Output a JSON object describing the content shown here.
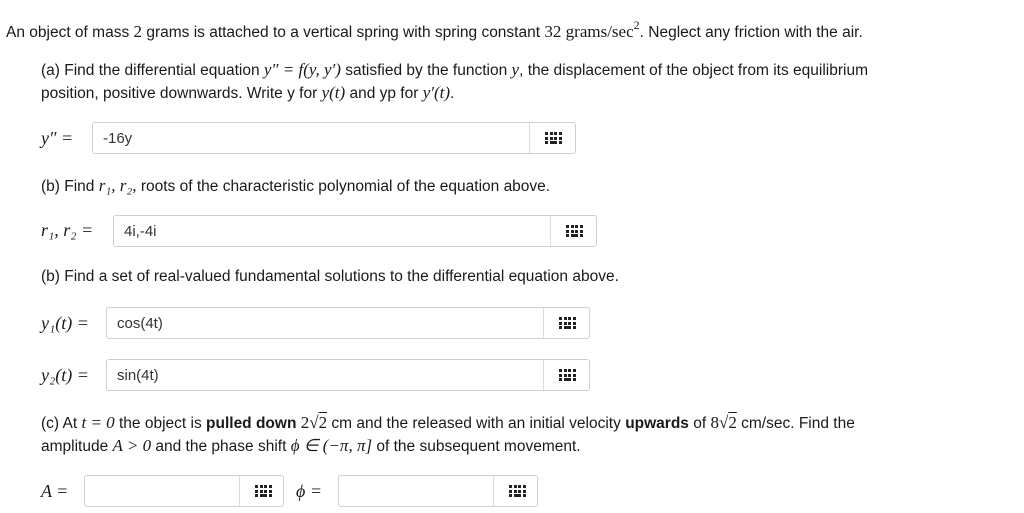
{
  "intro": {
    "text1": "An object of mass ",
    "mass": "2",
    "text2": " grams is attached to a vertical spring with spring constant ",
    "k": "32",
    "units": "grams/sec",
    "units_exp": "2",
    "text3": ". Neglect any friction with the air."
  },
  "part_a": {
    "prompt1": "(a) Find the differential equation ",
    "eq_lhs": "y″",
    "eq_rhs": " = f(y, y′)",
    "prompt2": " satisfied by the function ",
    "var_y": "y",
    "prompt3": ", the displacement of the object from its equilibrium",
    "prompt4": "position, positive downwards. Write y for ",
    "yt": "y(t)",
    "prompt5": " and yp for ",
    "ypt": "y′(t)",
    "prompt6": ".",
    "label": "y″ =",
    "value": "-16y",
    "placeholder": ""
  },
  "part_b1": {
    "prompt1": "(b) Find ",
    "roots": "r₁, r₂,",
    "prompt2": " roots of the characteristic polynomial of the equation above.",
    "label": "r₁, r₂ =",
    "value": "4i,-4i",
    "placeholder": ""
  },
  "part_b2": {
    "prompt": "(b) Find a set of real-valued fundamental solutions to the differential equation above.",
    "y1_label": "y₁(t) =",
    "y1_value": "cos(4t)",
    "y2_label": "y₂(t) =",
    "y2_value": "sin(4t)"
  },
  "part_c": {
    "p1": "(c) At ",
    "t_eq": "t = 0",
    "p2": " the object is ",
    "bold1": "pulled down",
    "p3": " ",
    "disp_coef": "2",
    "disp_rad": "2",
    "p4": " cm and the released with an initial velocity ",
    "bold2": "upwards",
    "p5": " of ",
    "vel_coef": "8",
    "vel_rad": "2",
    "p6": " cm/sec. Find the",
    "p7": "amplitude ",
    "amp_cond": "A > 0",
    "p8": " and the phase shift ",
    "phi_cond": "ϕ ∈ (−π, π]",
    "p9": " of the subsequent movement.",
    "A_label": "A =",
    "A_value": "",
    "phi_label": "ϕ =",
    "phi_value": ""
  },
  "icons": {
    "keyboard": "keypad-grid-icon"
  }
}
